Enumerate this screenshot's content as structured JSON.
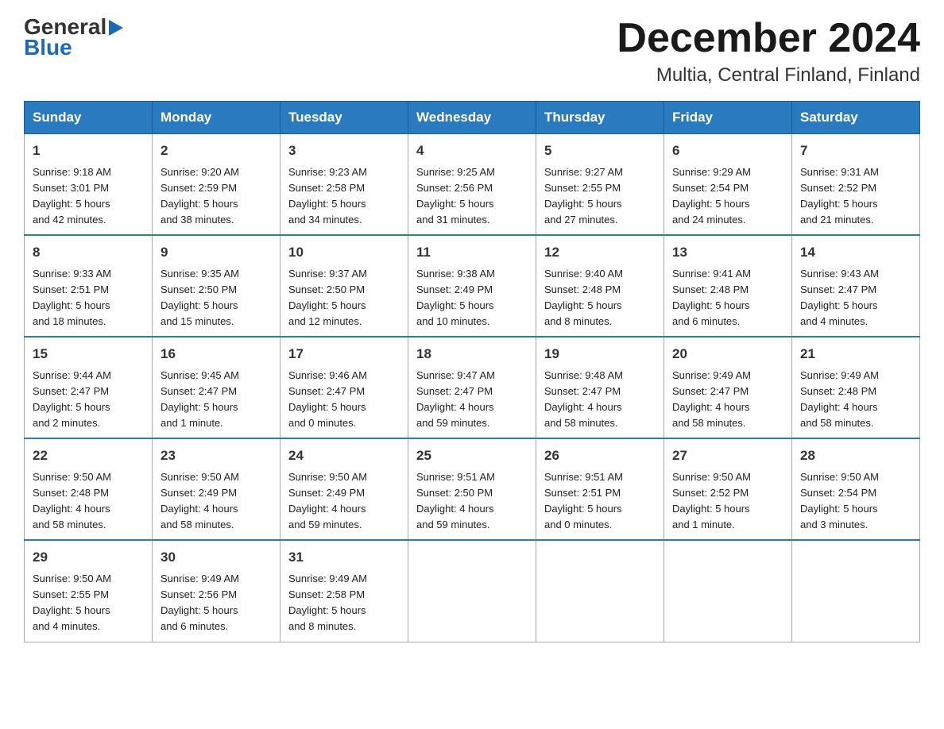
{
  "header": {
    "logo_line1": "General",
    "logo_line2": "Blue",
    "month_title": "December 2024",
    "location": "Multia, Central Finland, Finland"
  },
  "weekdays": [
    "Sunday",
    "Monday",
    "Tuesday",
    "Wednesday",
    "Thursday",
    "Friday",
    "Saturday"
  ],
  "weeks": [
    [
      {
        "day": "1",
        "sunrise": "9:18 AM",
        "sunset": "3:01 PM",
        "daylight": "5 hours and 42 minutes."
      },
      {
        "day": "2",
        "sunrise": "9:20 AM",
        "sunset": "2:59 PM",
        "daylight": "5 hours and 38 minutes."
      },
      {
        "day": "3",
        "sunrise": "9:23 AM",
        "sunset": "2:58 PM",
        "daylight": "5 hours and 34 minutes."
      },
      {
        "day": "4",
        "sunrise": "9:25 AM",
        "sunset": "2:56 PM",
        "daylight": "5 hours and 31 minutes."
      },
      {
        "day": "5",
        "sunrise": "9:27 AM",
        "sunset": "2:55 PM",
        "daylight": "5 hours and 27 minutes."
      },
      {
        "day": "6",
        "sunrise": "9:29 AM",
        "sunset": "2:54 PM",
        "daylight": "5 hours and 24 minutes."
      },
      {
        "day": "7",
        "sunrise": "9:31 AM",
        "sunset": "2:52 PM",
        "daylight": "5 hours and 21 minutes."
      }
    ],
    [
      {
        "day": "8",
        "sunrise": "9:33 AM",
        "sunset": "2:51 PM",
        "daylight": "5 hours and 18 minutes."
      },
      {
        "day": "9",
        "sunrise": "9:35 AM",
        "sunset": "2:50 PM",
        "daylight": "5 hours and 15 minutes."
      },
      {
        "day": "10",
        "sunrise": "9:37 AM",
        "sunset": "2:50 PM",
        "daylight": "5 hours and 12 minutes."
      },
      {
        "day": "11",
        "sunrise": "9:38 AM",
        "sunset": "2:49 PM",
        "daylight": "5 hours and 10 minutes."
      },
      {
        "day": "12",
        "sunrise": "9:40 AM",
        "sunset": "2:48 PM",
        "daylight": "5 hours and 8 minutes."
      },
      {
        "day": "13",
        "sunrise": "9:41 AM",
        "sunset": "2:48 PM",
        "daylight": "5 hours and 6 minutes."
      },
      {
        "day": "14",
        "sunrise": "9:43 AM",
        "sunset": "2:47 PM",
        "daylight": "5 hours and 4 minutes."
      }
    ],
    [
      {
        "day": "15",
        "sunrise": "9:44 AM",
        "sunset": "2:47 PM",
        "daylight": "5 hours and 2 minutes."
      },
      {
        "day": "16",
        "sunrise": "9:45 AM",
        "sunset": "2:47 PM",
        "daylight": "5 hours and 1 minute."
      },
      {
        "day": "17",
        "sunrise": "9:46 AM",
        "sunset": "2:47 PM",
        "daylight": "5 hours and 0 minutes."
      },
      {
        "day": "18",
        "sunrise": "9:47 AM",
        "sunset": "2:47 PM",
        "daylight": "4 hours and 59 minutes."
      },
      {
        "day": "19",
        "sunrise": "9:48 AM",
        "sunset": "2:47 PM",
        "daylight": "4 hours and 58 minutes."
      },
      {
        "day": "20",
        "sunrise": "9:49 AM",
        "sunset": "2:47 PM",
        "daylight": "4 hours and 58 minutes."
      },
      {
        "day": "21",
        "sunrise": "9:49 AM",
        "sunset": "2:48 PM",
        "daylight": "4 hours and 58 minutes."
      }
    ],
    [
      {
        "day": "22",
        "sunrise": "9:50 AM",
        "sunset": "2:48 PM",
        "daylight": "4 hours and 58 minutes."
      },
      {
        "day": "23",
        "sunrise": "9:50 AM",
        "sunset": "2:49 PM",
        "daylight": "4 hours and 58 minutes."
      },
      {
        "day": "24",
        "sunrise": "9:50 AM",
        "sunset": "2:49 PM",
        "daylight": "4 hours and 59 minutes."
      },
      {
        "day": "25",
        "sunrise": "9:51 AM",
        "sunset": "2:50 PM",
        "daylight": "4 hours and 59 minutes."
      },
      {
        "day": "26",
        "sunrise": "9:51 AM",
        "sunset": "2:51 PM",
        "daylight": "5 hours and 0 minutes."
      },
      {
        "day": "27",
        "sunrise": "9:50 AM",
        "sunset": "2:52 PM",
        "daylight": "5 hours and 1 minute."
      },
      {
        "day": "28",
        "sunrise": "9:50 AM",
        "sunset": "2:54 PM",
        "daylight": "5 hours and 3 minutes."
      }
    ],
    [
      {
        "day": "29",
        "sunrise": "9:50 AM",
        "sunset": "2:55 PM",
        "daylight": "5 hours and 4 minutes."
      },
      {
        "day": "30",
        "sunrise": "9:49 AM",
        "sunset": "2:56 PM",
        "daylight": "5 hours and 6 minutes."
      },
      {
        "day": "31",
        "sunrise": "9:49 AM",
        "sunset": "2:58 PM",
        "daylight": "5 hours and 8 minutes."
      },
      null,
      null,
      null,
      null
    ]
  ],
  "labels": {
    "sunrise": "Sunrise:",
    "sunset": "Sunset:",
    "daylight": "Daylight:"
  }
}
